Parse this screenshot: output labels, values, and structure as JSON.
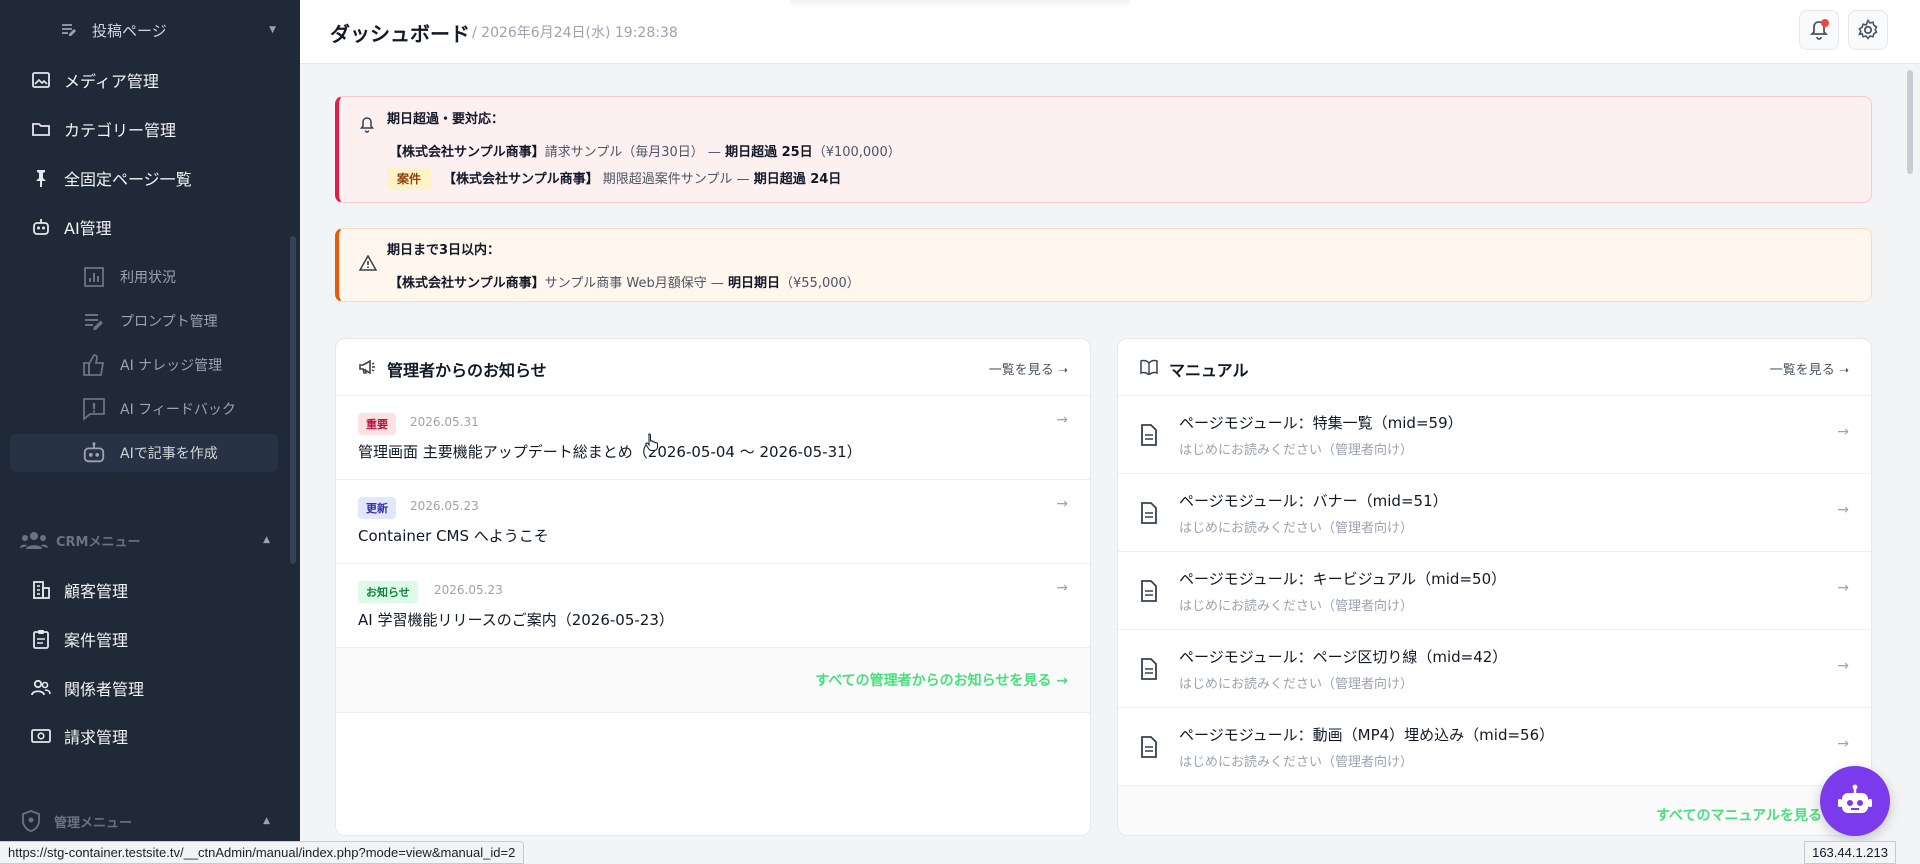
{
  "sidebar": {
    "top_item": "投稿ページ",
    "items": [
      {
        "label": "メディア管理",
        "icon": "image-icon"
      },
      {
        "label": "カテゴリー管理",
        "icon": "folder-icon"
      },
      {
        "label": "全固定ページ一覧",
        "icon": "pin-icon"
      },
      {
        "label": "AI管理",
        "icon": "robot-icon"
      }
    ],
    "ai_sub": [
      {
        "label": "利用状況",
        "icon": "chart-icon"
      },
      {
        "label": "プロンプト管理",
        "icon": "edit-list-icon"
      },
      {
        "label": "AI ナレッジ管理",
        "icon": "thumbs-up-icon"
      },
      {
        "label": "AI フィードバック",
        "icon": "feedback-icon"
      },
      {
        "label": "AIで記事を作成",
        "icon": "robot-icon"
      }
    ],
    "crm_section": "CRMメニュー",
    "crm_items": [
      {
        "label": "顧客管理",
        "icon": "building-icon"
      },
      {
        "label": "案件管理",
        "icon": "clipboard-icon"
      },
      {
        "label": "関係者管理",
        "icon": "people-icon"
      },
      {
        "label": "請求管理",
        "icon": "money-icon"
      }
    ],
    "admin_section": "管理メニュー"
  },
  "header": {
    "title": "ダッシュボード",
    "date": "/ 2026年6月24日(水) 19:28:38"
  },
  "alert_overdue": {
    "heading": "期日超過・要対応：",
    "line1": {
      "company": "【株式会社サンプル商事】",
      "item": "請求サンプル（毎月30日）",
      "dash": "—",
      "status": "期日超過 25日",
      "amount": "（¥100,000）"
    },
    "line2": {
      "tag": "案件",
      "company": "【株式会社サンプル商事】",
      "item": "期限超過案件サンプル",
      "dash": "—",
      "status": "期日超過 24日"
    }
  },
  "alert_soon": {
    "heading": "期日まで3日以内：",
    "line1": {
      "company": "【株式会社サンプル商事】",
      "item": "サンプル商事 Web月額保守",
      "dash": "—",
      "status": "明日期日",
      "amount": "（¥55,000）"
    }
  },
  "news": {
    "title": "管理者からのお知らせ",
    "view_all": "一覧を見る",
    "items": [
      {
        "badge": "重要",
        "date": "2026.05.31",
        "title": "管理画面 主要機能アップデート総まとめ（2026-05-04 〜 2026-05-31）"
      },
      {
        "badge": "更新",
        "date": "2026.05.23",
        "title": "Container CMS へようこそ"
      },
      {
        "badge": "お知らせ",
        "date": "2026.05.23",
        "title": "AI 学習機能リリースのご案内（2026-05-23）"
      }
    ],
    "all_link": "すべての管理者からのお知らせを見る →"
  },
  "manual": {
    "title": "マニュアル",
    "view_all": "一覧を見る",
    "items": [
      {
        "title": "ページモジュール：特集一覧（mid=59）",
        "sub": "はじめにお読みください（管理者向け）"
      },
      {
        "title": "ページモジュール：バナー（mid=51）",
        "sub": "はじめにお読みください（管理者向け）"
      },
      {
        "title": "ページモジュール：キービジュアル（mid=50）",
        "sub": "はじめにお読みください（管理者向け）"
      },
      {
        "title": "ページモジュール：ページ区切り線（mid=42）",
        "sub": "はじめにお読みください（管理者向け）"
      },
      {
        "title": "ページモジュール：動画（MP4）埋め込み（mid=56）",
        "sub": "はじめにお読みください（管理者向け）"
      }
    ],
    "all_link": "すべてのマニュアルを見る →"
  },
  "arrow": "→",
  "status_url": "https://stg-container.testsite.tv/__ctnAdmin/manual/index.php?mode=view&manual_id=2",
  "ip": "163.44.1.213",
  "colors": {
    "sidebar": "#1f2937",
    "accent_green": "#4ade80",
    "danger": "#e11d48",
    "warning": "#ea580c",
    "fab": "#7c3aed"
  }
}
